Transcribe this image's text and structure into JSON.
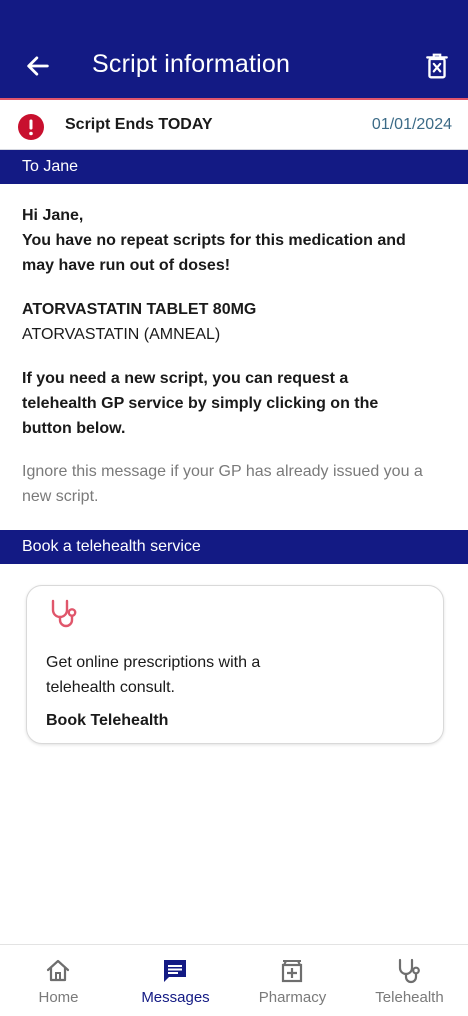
{
  "header": {
    "title": "Script information",
    "back_icon": "arrow-left-icon",
    "delete_icon": "delete-icon"
  },
  "status": {
    "label": "Script Ends TODAY",
    "date": "01/01/2024",
    "icon": "alert-icon"
  },
  "section_to": {
    "title": "To Jane"
  },
  "message": {
    "greeting": "Hi Jane,",
    "warning": "You have no repeat scripts for this medication and may have run out of doses!",
    "drug_name": "ATORVASTATIN TABLET 80MG",
    "drug_generic": "ATORVASTATIN (AMNEAL)",
    "instructions": "If you need a new script, you can request a telehealth GP service by simply clicking on the button below.",
    "note": "Ignore this message if your GP has already issued you a new script."
  },
  "section_book": {
    "title": "Book a telehealth service"
  },
  "card": {
    "icon": "stethoscope-icon",
    "description": "Get online prescriptions with a telehealth consult.",
    "cta": "Book Telehealth"
  },
  "nav": {
    "items": [
      {
        "label": "Home",
        "icon": "home-icon"
      },
      {
        "label": "Messages",
        "icon": "messages-icon",
        "active": true
      },
      {
        "label": "Pharmacy",
        "icon": "pharmacy-icon"
      },
      {
        "label": "Telehealth",
        "icon": "stethoscope-icon"
      }
    ]
  },
  "colors": {
    "primary": "#131a84",
    "accent": "#e0566b",
    "alert": "#c8102e",
    "date": "#3c6b87",
    "muted": "#7a7a7a"
  }
}
